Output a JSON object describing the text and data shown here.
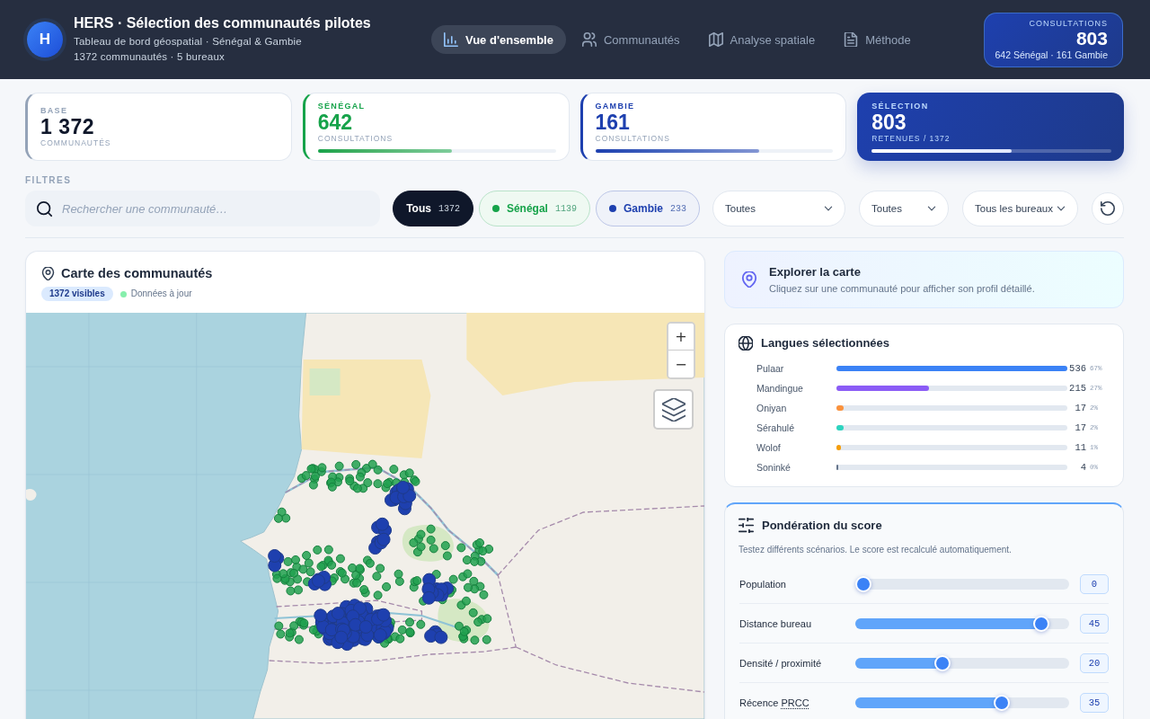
{
  "header": {
    "logo": "H",
    "title": "HERS · Sélection des communautés pilotes",
    "subtitle": "Tableau de bord géospatial · Sénégal & Gambie",
    "summary": "1372 communautés · 5 bureaux"
  },
  "nav": [
    {
      "label": "Vue d'ensemble",
      "selected": true
    },
    {
      "label": "Communautés",
      "selected": false
    },
    {
      "label": "Analyse spatiale",
      "selected": false
    },
    {
      "label": "Méthode",
      "selected": false
    }
  ],
  "consultations": {
    "label": "CONSULTATIONS",
    "value": "803",
    "detail": "642 Sénégal · 161 Gambie"
  },
  "stats": [
    {
      "kind": "total",
      "label": "BASE",
      "value": "1 372",
      "caption": "COMMUNAUTÉS",
      "color": "#94a3b8"
    },
    {
      "kind": "country",
      "label": "SÉNÉGAL",
      "value": "642",
      "caption": "CONSULTATIONS",
      "color": "#16a34a",
      "level": 0.564
    },
    {
      "kind": "country",
      "label": "GAMBIE",
      "value": "161",
      "caption": "CONSULTATIONS",
      "color": "#1e40af",
      "level": 0.691
    },
    {
      "kind": "selection",
      "label": "SÉLECTION",
      "value": "803",
      "caption": "RETENUES / 1372",
      "level": 0.585
    }
  ],
  "filters": {
    "title": "FILTRES",
    "search": {
      "placeholder": "Rechercher une communauté…"
    },
    "chips": [
      {
        "label": "Tous",
        "count": "1372",
        "selected": true
      },
      {
        "label": "Sénégal",
        "count": "1139",
        "selected": false,
        "color": "#16a34a"
      },
      {
        "label": "Gambie",
        "count": "233",
        "selected": false,
        "color": "#1e40af"
      }
    ],
    "selects": [
      {
        "value": "Toutes"
      },
      {
        "value": "Toutes"
      },
      {
        "value": "Tous les bureaux"
      }
    ]
  },
  "map": {
    "title": "Carte des communautés",
    "visible_badge": "1372 visibles",
    "status": "Données à jour",
    "zoom_in": "+",
    "zoom_out": "−"
  },
  "explore": {
    "title": "Explorer la carte",
    "text": "Cliquez sur une communauté pour afficher son profil détaillé."
  },
  "languages": {
    "title": "Langues sélectionnées",
    "items": [
      {
        "name": "Pulaar",
        "count": "536",
        "share": "67%",
        "level": 1,
        "color": "#3b82f6"
      },
      {
        "name": "Mandingue",
        "count": "215",
        "share": "27%",
        "level": 0.401,
        "color": "#8b5cf6"
      },
      {
        "name": "Oniyan",
        "count": "17",
        "share": "2%",
        "level": 0.032,
        "color": "#fb923c"
      },
      {
        "name": "Sérahulé",
        "count": "17",
        "share": "2%",
        "level": 0.032,
        "color": "#2dd4bf"
      },
      {
        "name": "Wolof",
        "count": "11",
        "share": "1%",
        "level": 0.021,
        "color": "#f59e0b"
      },
      {
        "name": "Soninké",
        "count": "4",
        "share": "0%",
        "level": 0.0075,
        "color": "#64748b"
      }
    ]
  },
  "weights": {
    "title": "Pondération du score",
    "description": "Testez différents scénarios. Le score est recalculé automatiquement.",
    "items": [
      {
        "label": "Population",
        "value": "0",
        "level": 0
      },
      {
        "label": "Distance bureau",
        "value": "45",
        "level": 0.9
      },
      {
        "label": "Densité / proximité",
        "value": "20",
        "level": 0.4
      },
      {
        "label": "Récence",
        "abbr": "PRCC",
        "value": "35",
        "level": 0.7
      }
    ]
  }
}
